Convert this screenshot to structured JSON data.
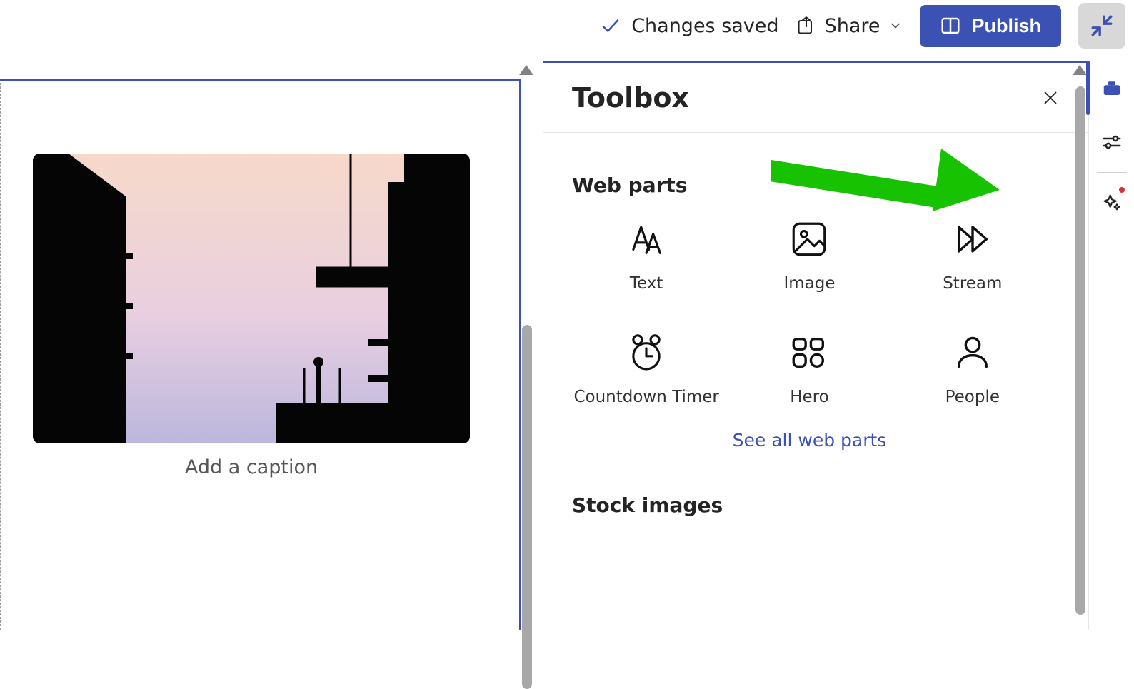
{
  "topbar": {
    "status_label": "Changes saved",
    "share_label": "Share",
    "publish_label": "Publish"
  },
  "canvas": {
    "caption_placeholder": "Add a caption"
  },
  "toolbox": {
    "title": "Toolbox",
    "sections": {
      "webparts": {
        "heading": "Web parts",
        "items": [
          {
            "key": "text",
            "label": "Text"
          },
          {
            "key": "image",
            "label": "Image"
          },
          {
            "key": "stream",
            "label": "Stream"
          },
          {
            "key": "countdown",
            "label": "Countdown Timer"
          },
          {
            "key": "hero",
            "label": "Hero"
          },
          {
            "key": "people",
            "label": "People"
          }
        ],
        "see_all_label": "See all web parts"
      },
      "stock_images": {
        "heading": "Stock images"
      }
    }
  },
  "rail": {
    "items": [
      {
        "key": "toolbox",
        "icon": "toolbox-icon",
        "active": true
      },
      {
        "key": "settings",
        "icon": "sliders-icon",
        "active": false
      },
      {
        "key": "ai",
        "icon": "sparkle-icon",
        "active": false,
        "badge": true
      }
    ]
  },
  "colors": {
    "brand": "#3b51b3",
    "annotation_arrow": "#17c300"
  }
}
